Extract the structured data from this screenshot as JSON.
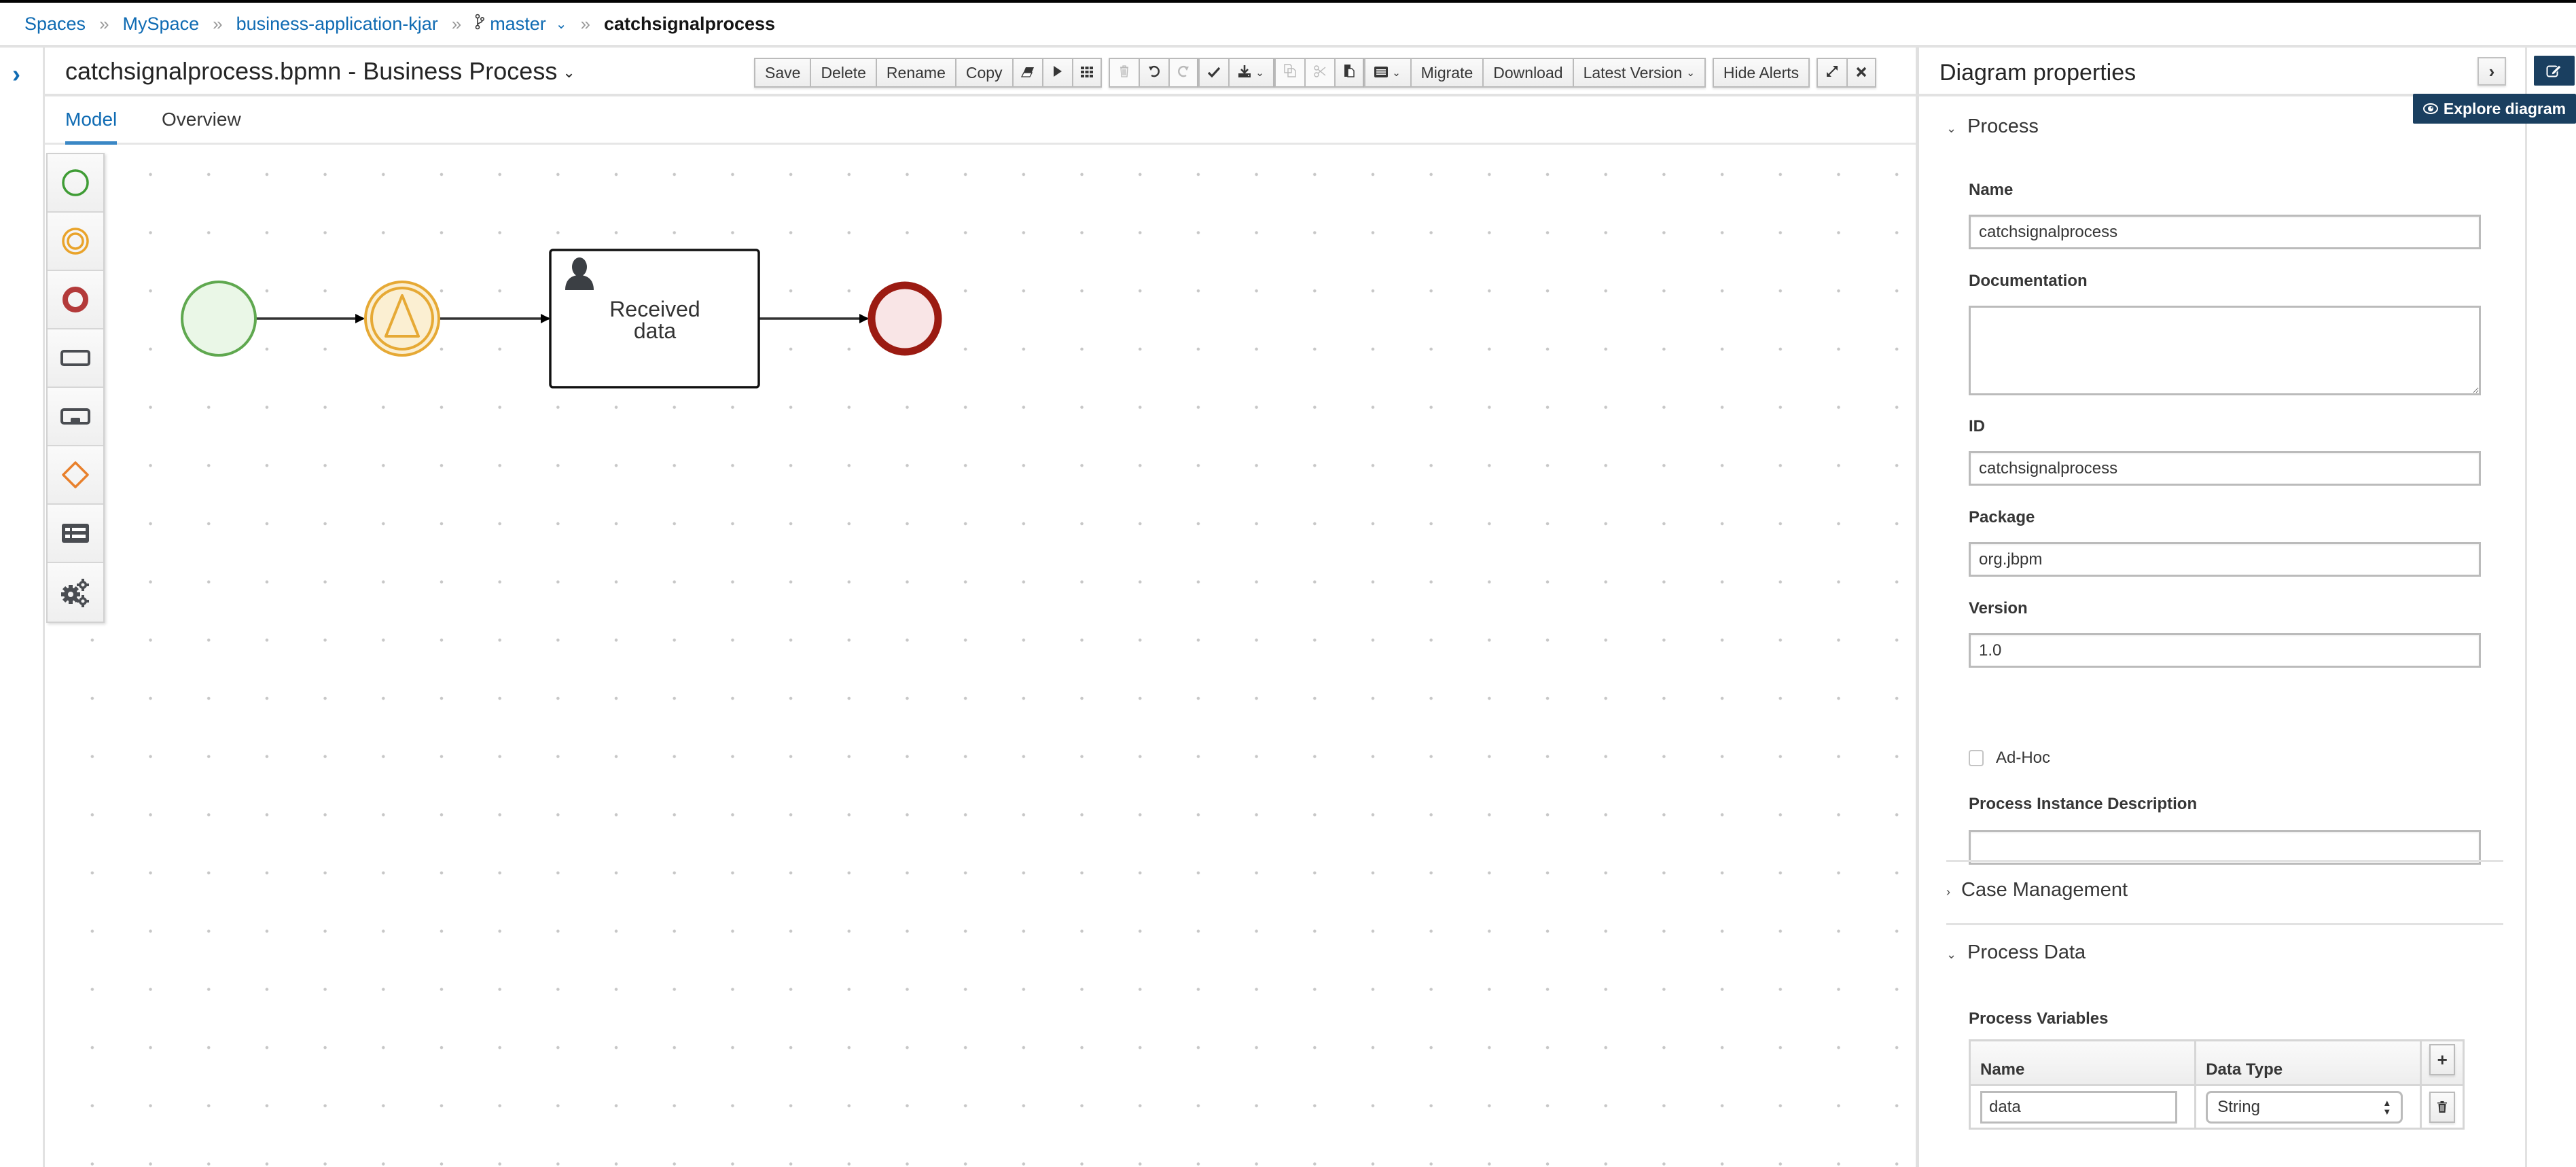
{
  "breadcrumb": {
    "items": [
      "Spaces",
      "MySpace",
      "business-application-kjar",
      "master"
    ],
    "separator": "»",
    "current": "catchsignalprocess",
    "branch_icon": "code-branch-icon"
  },
  "editor": {
    "title": "catchsignalprocess.bpmn - Business Process",
    "title_caret": "⌄"
  },
  "toolbar": {
    "save": "Save",
    "delete": "Delete",
    "rename": "Rename",
    "copy": "Copy",
    "migrate": "Migrate",
    "download": "Download",
    "latest_version": "Latest Version",
    "hide_alerts": "Hide Alerts",
    "icons": {
      "clear": "eraser-icon",
      "run": "play-icon",
      "grid": "grid-icon",
      "delete_selection": "trash-icon",
      "undo": "undo-icon",
      "redo": "redo-icon",
      "validate": "check-icon",
      "export": "download-icon",
      "copy_selection": "copy-icon",
      "cut": "scissors-icon",
      "paste": "paste-icon",
      "view": "list-view-icon",
      "maximize": "expand-icon",
      "close": "close-icon"
    }
  },
  "tabs": [
    {
      "label": "Model",
      "active": true
    },
    {
      "label": "Overview",
      "active": false
    }
  ],
  "palette": [
    {
      "name": "start-events",
      "icon": "start-event-icon",
      "color": "#3f9c35"
    },
    {
      "name": "intermediate-events",
      "icon": "intermediate-event-icon",
      "color": "#e9a32a"
    },
    {
      "name": "end-events",
      "icon": "end-event-icon",
      "color": "#b33a3a"
    },
    {
      "name": "activities",
      "icon": "task-icon",
      "color": "#4a4d52"
    },
    {
      "name": "subprocesses",
      "icon": "subprocess-icon",
      "color": "#4a4d52"
    },
    {
      "name": "gateways",
      "icon": "gateway-icon",
      "color": "#e8802c"
    },
    {
      "name": "containers",
      "icon": "lane-icon",
      "color": "#4a4d52"
    },
    {
      "name": "service-tasks",
      "icon": "gears-icon",
      "color": "#4a4d52"
    }
  ],
  "diagram": {
    "nodes": [
      {
        "id": "start",
        "type": "start-event"
      },
      {
        "id": "signal",
        "type": "intermediate-catch-signal-event"
      },
      {
        "id": "task",
        "type": "user-task",
        "label_lines": [
          "Received",
          "data"
        ]
      },
      {
        "id": "end",
        "type": "end-event"
      }
    ],
    "flows": [
      [
        "start",
        "signal"
      ],
      [
        "signal",
        "task"
      ],
      [
        "task",
        "end"
      ]
    ],
    "colors": {
      "start_stroke": "#5fa84f",
      "start_fill": "#eaf7e7",
      "signal_stroke": "#e6a935",
      "signal_fill": "#fbefd2",
      "end_stroke": "#9b1b12",
      "end_fill": "#f9e5e6",
      "task_stroke": "#111111"
    }
  },
  "properties": {
    "title": "Diagram properties",
    "collapse_icon": "chevron-right-icon",
    "sections": {
      "process": "Process",
      "case_management": "Case Management",
      "process_data": "Process Data"
    },
    "fields": {
      "name_label": "Name",
      "name_value": "catchsignalprocess",
      "documentation_label": "Documentation",
      "documentation_value": "",
      "id_label": "ID",
      "id_value": "catchsignalprocess",
      "package_label": "Package",
      "package_value": "org.jbpm",
      "version_label": "Version",
      "version_value": "1.0",
      "adhoc_label": "Ad-Hoc",
      "adhoc_checked": false,
      "instance_desc_label": "Process Instance Description",
      "instance_desc_value": ""
    },
    "process_variables": {
      "label": "Process Variables",
      "columns": [
        "Name",
        "Data Type"
      ],
      "rows": [
        {
          "name": "data",
          "type": "String"
        }
      ]
    }
  },
  "explore_diagram": {
    "label": "Explore diagram",
    "icon": "eye-icon"
  },
  "side_rail": {
    "edit_icon": "edit-icon",
    "accent": "#1a3f60"
  }
}
